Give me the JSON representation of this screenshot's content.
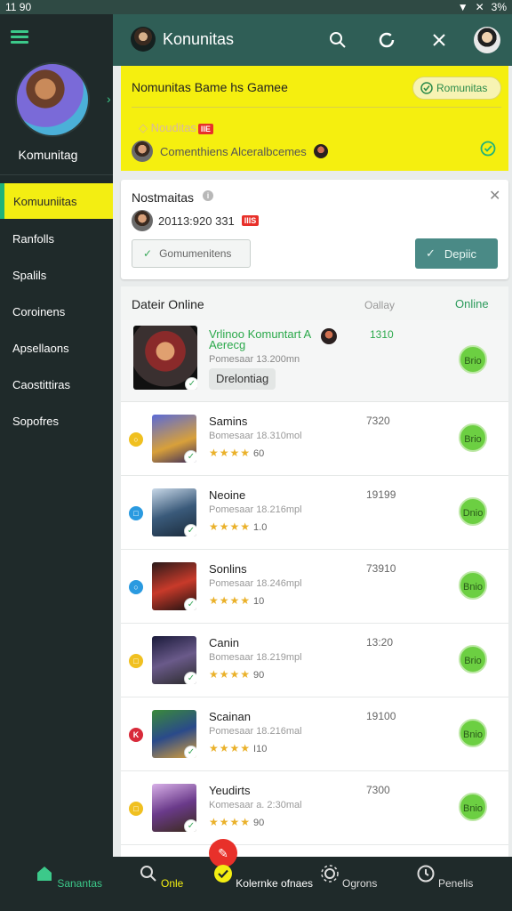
{
  "status_bar": {
    "time": "11 90",
    "battery": "3%"
  },
  "sidebar": {
    "username": "Komunitag",
    "items": [
      {
        "label": "Komuuniitas"
      },
      {
        "label": "Ranfolls"
      },
      {
        "label": "Spalils"
      },
      {
        "label": "Coroinens"
      },
      {
        "label": "Apsellaons"
      },
      {
        "label": "Caostittiras"
      },
      {
        "label": "Sopofres"
      }
    ]
  },
  "header": {
    "title": "Konunitas"
  },
  "banner": {
    "title": "Nomunitas Bame hs Gamee",
    "pill_label": "Romunitas",
    "badge_label": "Nouditas",
    "badge_hot": "IIE",
    "subtitle": "Comenthiens Alceralbcemes"
  },
  "notice": {
    "title": "Nostmaitas",
    "info_glyph": "i",
    "time": "20113:920 331",
    "hot": "IIIS",
    "secondary_label": "Gomumenitens",
    "primary_label": "Depiic"
  },
  "list": {
    "title": "Dateir Online",
    "col_label": "Oallay",
    "online_label": "Online",
    "featured": {
      "title": "Vrlinoo Komuntart A Aerecg",
      "meta": "Pomesaar 13.200mn",
      "time": "1310",
      "tag": "Drelontiag",
      "play": "Brio"
    },
    "rows": [
      {
        "name": "Samins",
        "meta": "Bomesaar 18.310mol",
        "stars": "★★★★",
        "count": "60",
        "time": "7320",
        "dot_color": "#f0c020",
        "dot_glyph": "○",
        "play": "Brio"
      },
      {
        "name": "Neoine",
        "meta": "Pomesaar 18.216mpl",
        "stars": "★★★★",
        "count": "1.0",
        "time": "19199",
        "dot_color": "#2a9ae0",
        "dot_glyph": "□",
        "play": "Dnio"
      },
      {
        "name": "Sonlins",
        "meta": "Pomesaar 18.246mpl",
        "stars": "★★★★",
        "count": "10",
        "time": "73910",
        "dot_color": "#2a9ae0",
        "dot_glyph": "○",
        "play": "Bnio"
      },
      {
        "name": "Canin",
        "meta": "Bomesaar 18.219mpl",
        "stars": "★★★★",
        "count": "90",
        "time": "13:20",
        "dot_color": "#f0c020",
        "dot_glyph": "□",
        "play": "Brio"
      },
      {
        "name": "Scainan",
        "meta": "Pomesaar 18.216mal",
        "stars": "★★★★",
        "count": "I10",
        "time": "19100",
        "dot_color": "#d82a3a",
        "dot_glyph": "K",
        "play": "Bnio"
      },
      {
        "name": "Yeudirts",
        "meta": "Komesaar a. 2:30mal",
        "stars": "★★★★",
        "count": "90",
        "time": "7300",
        "dot_color": "#f0c020",
        "dot_glyph": "□",
        "play": "Bnio"
      }
    ]
  },
  "bottom_nav": [
    {
      "label": "Sanantas",
      "icon": "home-icon",
      "color": "#3cc98a"
    },
    {
      "label": "Onle",
      "icon": "search-icon",
      "color": "#f3ee12"
    },
    {
      "label": "Kolernke ofnaes",
      "icon": "check-circle-icon",
      "color": "#ffffff"
    },
    {
      "label": "Ogrons",
      "icon": "gear-icon",
      "color": "#dddddd"
    },
    {
      "label": "Penelis",
      "icon": "clock-icon",
      "color": "#dddddd"
    }
  ],
  "colors": {
    "accent": "#3cc98a",
    "header": "#2f5e56",
    "highlight": "#f3ee12",
    "play": "#6ccf42"
  }
}
